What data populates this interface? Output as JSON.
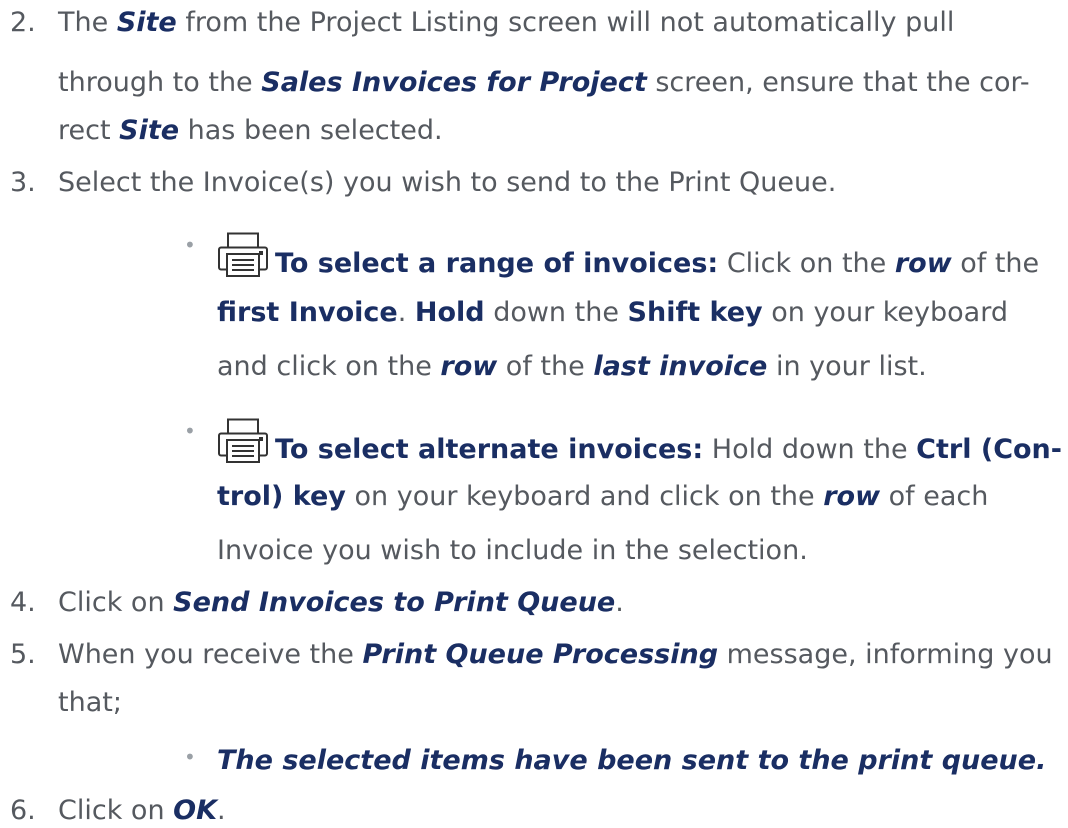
{
  "steps": [
    {
      "number": "2.",
      "lines": [
        [
          "The ",
          "Site",
          " from the Project Listing screen will not automatically pull"
        ],
        [
          "through to the ",
          "Sales Invoices for Project",
          " screen, ensure that the cor-"
        ],
        [
          "rect ",
          "Site",
          " has been selected."
        ]
      ]
    },
    {
      "number": "3.",
      "text": "Select the Invoice(s) you wish to send to the Print Queue.",
      "bullets": [
        {
          "icon": "printer-icon",
          "heading": "To select a range of invoices:",
          "l1a": " Click on the ",
          "l1b": "row",
          "l1c": " of the",
          "l2a": "first Invoice",
          "l2b": ". ",
          "l2c": "Hold",
          "l2d": " down the ",
          "l2e": "Shift key",
          "l2f": " on your keyboard",
          "l3a": "and click on the ",
          "l3b": "row",
          "l3c": " of the ",
          "l3d": "last invoice",
          "l3e": " in your list."
        },
        {
          "icon": "printer-icon",
          "heading": "To select alternate invoices:",
          "l1a": " Hold down the ",
          "l1b": "Ctrl (Con-",
          "l2a": "trol) key",
          "l2b": " on your keyboard and click on the ",
          "l2c": "row",
          "l2d": " of each",
          "l3a": "Invoice you wish to include in the selection."
        }
      ]
    },
    {
      "number": "4.",
      "a": "Click on ",
      "b": "Send Invoices to Print Queue",
      "c": "."
    },
    {
      "number": "5.",
      "a": "When you receive the ",
      "b": "Print Queue Processing",
      "c": " message, informing you",
      "d": "that;",
      "bullet": "The selected items have been sent to the print queue."
    },
    {
      "number": "6.",
      "a": "Click on ",
      "b": "OK",
      "c": "."
    }
  ],
  "colors": {
    "text": "#55595f",
    "emphasis": "#1a2e63",
    "bullet": "#9aa0a6"
  }
}
